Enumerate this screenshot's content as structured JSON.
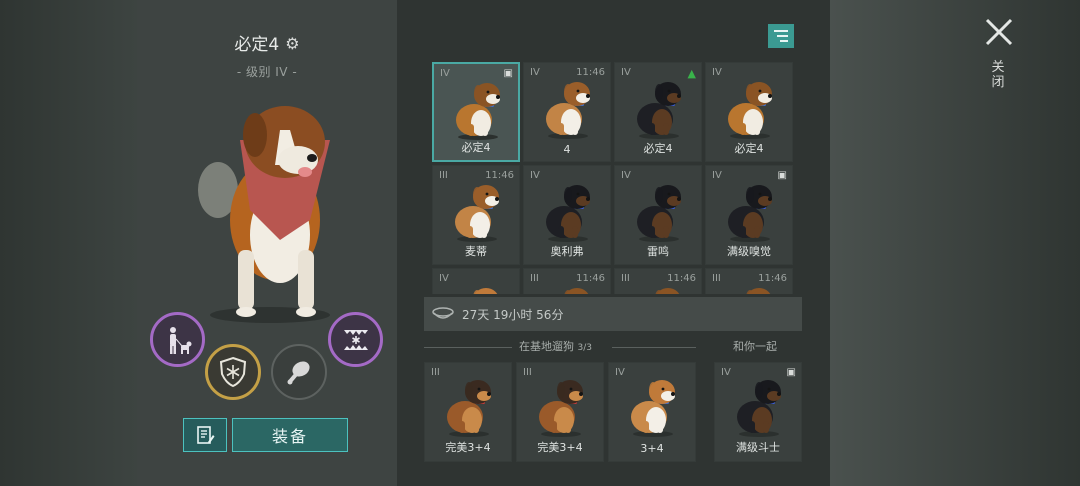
{
  "dog": {
    "name": "必定4",
    "level": "- 级别 IV -"
  },
  "actions": {
    "equip_label": "装备"
  },
  "close": {
    "label": "关闭"
  },
  "grid_cards": [
    {
      "tier": "IV",
      "time": "",
      "badge": "chest",
      "label": "必定4",
      "breed": "saint",
      "selected": true
    },
    {
      "tier": "IV",
      "time": "11:46",
      "badge": "",
      "label": "4",
      "breed": "saint-small",
      "selected": false
    },
    {
      "tier": "IV",
      "time": "",
      "badge": "up",
      "label": "必定4",
      "breed": "rott",
      "selected": false
    },
    {
      "tier": "IV",
      "time": "",
      "badge": "",
      "label": "必定4",
      "breed": "saint",
      "selected": false
    },
    {
      "tier": "III",
      "time": "11:46",
      "badge": "",
      "label": "麦蒂",
      "breed": "saint-small",
      "selected": false
    },
    {
      "tier": "IV",
      "time": "",
      "badge": "",
      "label": "奥利弗",
      "breed": "rott",
      "selected": false
    },
    {
      "tier": "IV",
      "time": "",
      "badge": "",
      "label": "雷鸣",
      "breed": "rott",
      "selected": false
    },
    {
      "tier": "IV",
      "time": "",
      "badge": "chest",
      "label": "满级嗅觉",
      "breed": "rott",
      "selected": false
    },
    {
      "tier": "IV",
      "time": "",
      "badge": "",
      "label": "",
      "breed": "corgi",
      "selected": false
    },
    {
      "tier": "III",
      "time": "11:46",
      "badge": "",
      "label": "",
      "breed": "saint",
      "selected": false
    },
    {
      "tier": "III",
      "time": "11:46",
      "badge": "",
      "label": "",
      "breed": "saint",
      "selected": false
    },
    {
      "tier": "III",
      "time": "11:46",
      "badge": "",
      "label": "",
      "breed": "saint",
      "selected": false
    }
  ],
  "timer": {
    "text": "27天 19小时 56分"
  },
  "base_section": {
    "label": "在基地遛狗",
    "count": "3/3"
  },
  "with_you_section": {
    "label": "和你一起"
  },
  "base_dogs": [
    {
      "tier": "III",
      "label": "完美3+4",
      "breed": "shepherd"
    },
    {
      "tier": "III",
      "label": "完美3+4",
      "breed": "shepherd"
    },
    {
      "tier": "IV",
      "label": "3+4",
      "breed": "corgi"
    }
  ],
  "with_you_dog": {
    "tier": "IV",
    "label": "满级斗士",
    "breed": "rott",
    "badge": "chest"
  },
  "icons": {
    "settings": "gear-icon",
    "close": "close-icon",
    "sort": "sort-filter-icon",
    "timer": "food-bowl-icon",
    "notes": "notes-icon",
    "walk": "walk-dog-icon",
    "frost_shield": "frost-shield-icon",
    "meat": "meat-icon",
    "frost_fangs": "frost-fangs-icon"
  },
  "colors": {
    "accent": "#4cc2bf",
    "purple_ring": "#a46ac6",
    "gold_ring": "#c4a046"
  }
}
